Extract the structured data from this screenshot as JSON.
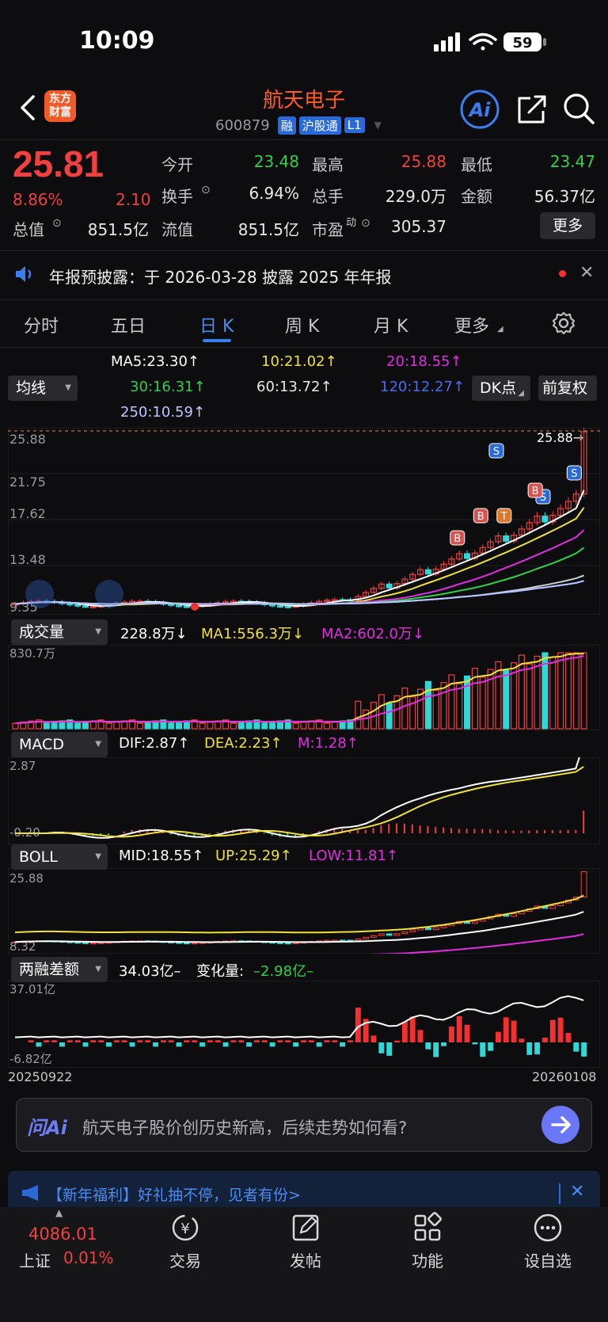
{
  "status_bar": {
    "time": "10:09",
    "battery": "59"
  },
  "header": {
    "logo_text": "东方财富",
    "stock_name": "航天电子",
    "stock_code": "600879",
    "tags": [
      "融",
      "沪股通",
      "L1"
    ],
    "ai_label": "Ai"
  },
  "quote": {
    "price": "25.81",
    "change_pct": "8.86%",
    "change": "2.10",
    "stats": [
      {
        "label": "今开",
        "value": "23.48",
        "color": "#2fd14a"
      },
      {
        "label": "最高",
        "value": "25.88",
        "color": "#f23f3f"
      },
      {
        "label": "最低",
        "value": "23.47",
        "color": "#2fd14a"
      },
      {
        "label": "换手",
        "value": "6.94%",
        "color": "#e8e8e8"
      },
      {
        "label": "总手",
        "value": "229.0万",
        "color": "#e8e8e8"
      },
      {
        "label": "金额",
        "value": "56.37亿",
        "color": "#e8e8e8"
      },
      {
        "label": "总值",
        "value": "851.5亿",
        "color": "#e8e8e8"
      },
      {
        "label": "流值",
        "value": "851.5亿",
        "color": "#e8e8e8"
      },
      {
        "label": "市盈",
        "value": "305.37",
        "color": "#e8e8e8"
      }
    ],
    "pe_superscript": "动",
    "more_label": "更多"
  },
  "notice": {
    "text": "年报预披露：于 2026-03-28 披露 2025 年年报"
  },
  "tabs": [
    {
      "label": "分时",
      "active": false
    },
    {
      "label": "五日",
      "active": false
    },
    {
      "label": "日 K",
      "active": true
    },
    {
      "label": "周 K",
      "active": false
    },
    {
      "label": "月 K",
      "active": false
    },
    {
      "label": "更多",
      "active": false
    }
  ],
  "ma_panel": {
    "selector": "均线",
    "items": [
      {
        "text": "MA5:23.30↑",
        "color": "#ffffff"
      },
      {
        "text": "10:21.02↑",
        "color": "#f0e03a"
      },
      {
        "text": "20:18.55↑",
        "color": "#e02ee0"
      },
      {
        "text": "30:16.31↑",
        "color": "#2fd14a"
      },
      {
        "text": "60:13.72↑",
        "color": "#e8e8e8"
      },
      {
        "text": "120:12.27↑",
        "color": "#4a6cf0"
      },
      {
        "text": "250:10.59↑",
        "color": "#b9c6ff"
      }
    ],
    "dk_button": "DK点",
    "fq_button": "前复权"
  },
  "kline": {
    "y_labels": [
      "25.88",
      "21.75",
      "17.62",
      "13.48",
      "9.35"
    ],
    "high_marker": "25.88→",
    "signals": [
      "S",
      "S",
      "S",
      "B",
      "B",
      "T",
      "B"
    ]
  },
  "volume": {
    "selector": "成交量",
    "current": "228.8万↓",
    "ma1": "MA1:556.3万↓",
    "ma2": "MA2:602.0万↓",
    "max_label": "830.7万"
  },
  "macd": {
    "selector": "MACD",
    "dif": "DIF:2.87↑",
    "dea": "DEA:2.23↑",
    "m": "M:1.28↑",
    "top_label": "2.87",
    "bottom_label": "-0.20"
  },
  "boll": {
    "selector": "BOLL",
    "mid": "MID:18.55↑",
    "up": "UP:25.29↑",
    "low": "LOW:11.81↑",
    "top_label": "25.88",
    "bottom_label": "8.32"
  },
  "margin": {
    "selector": "两融差额",
    "value": "34.03亿–",
    "change_label": "变化量:",
    "change_value": "–2.98亿–",
    "top_label": "37.01亿",
    "bottom_label": "-6.82亿",
    "start_date": "20250922",
    "end_date": "20260108"
  },
  "ask_ai": {
    "logo": "问Ai",
    "text": "航天电子股价创历史新高，后续走势如何看?"
  },
  "promo": {
    "text": "【新年福利】好礼抽不停，见者有份>"
  },
  "bottom_nav": {
    "index_value": "4086.01",
    "index_name": "上证",
    "index_change": "0.01%",
    "items": [
      "交易",
      "发帖",
      "功能",
      "设自选"
    ]
  }
}
